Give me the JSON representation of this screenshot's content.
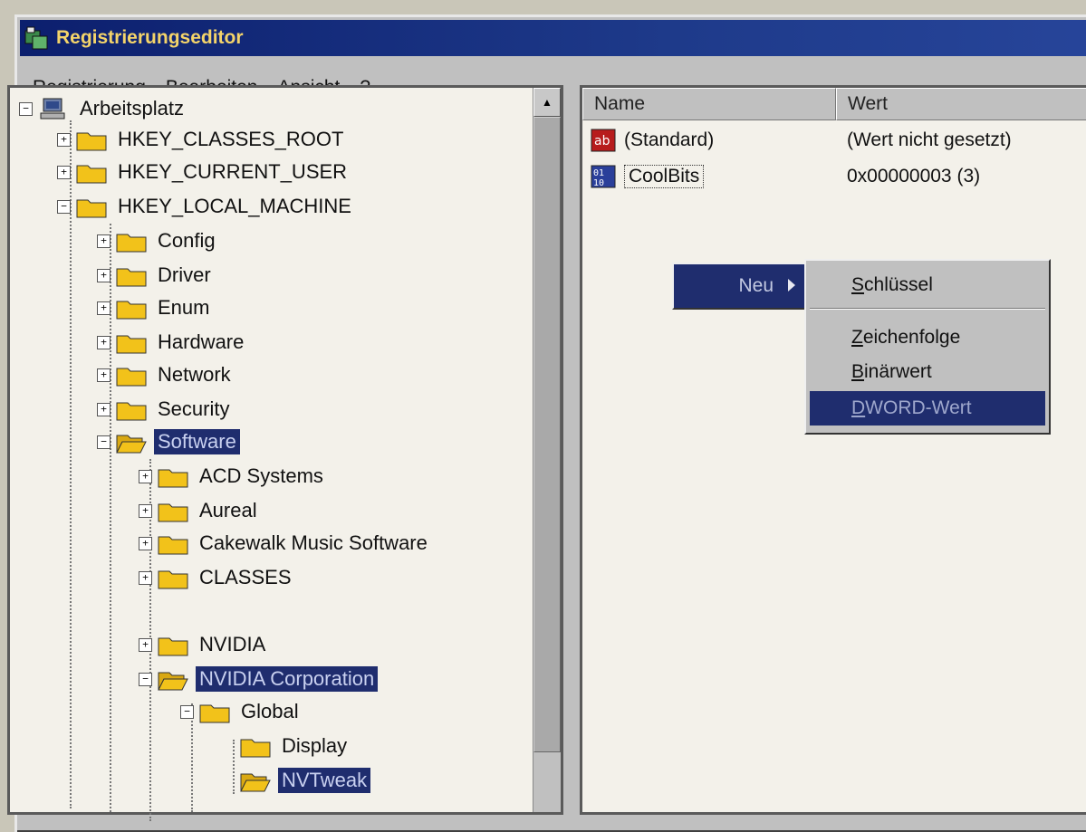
{
  "window": {
    "title": "Registrierungseditor"
  },
  "menubar": {
    "items": [
      {
        "underline": "R",
        "rest": "egistrierung"
      },
      {
        "underline": "B",
        "rest": "earbeiten"
      },
      {
        "underline": "A",
        "rest": "nsicht"
      },
      {
        "underline": "?",
        "rest": ""
      }
    ]
  },
  "tree": {
    "root": "Arbeitsplatz",
    "hkcr": "HKEY_CLASSES_ROOT",
    "hkcu": "HKEY_CURRENT_USER",
    "hklm": "HKEY_LOCAL_MACHINE",
    "config": "Config",
    "driver": "Driver",
    "enum": "Enum",
    "hardware": "Hardware",
    "network": "Network",
    "security": "Security",
    "software": "Software",
    "acd": "ACD Systems",
    "aureal": "Aureal",
    "cakewalk": "Cakewalk Music Software",
    "classes": "CLASSES",
    "nvidia": "NVIDIA",
    "nvidia_corp": "NVIDIA Corporation",
    "global": "Global",
    "display": "Display",
    "nvtweak": "NVTweak"
  },
  "list": {
    "col_name": "Name",
    "col_value": "Wert",
    "rows": [
      {
        "name": "(Standard)",
        "value": "(Wert nicht gesetzt)",
        "icon": "string-value-icon"
      },
      {
        "name": "CoolBits",
        "value": "0x00000003 (3)",
        "icon": "binary-value-icon"
      }
    ]
  },
  "context_menu": {
    "neu": "Neu",
    "submenu": [
      {
        "underline": "S",
        "rest": "chlüssel"
      },
      {
        "underline": "Z",
        "rest": "eichenfolge"
      },
      {
        "underline": "B",
        "rest": "inärwert"
      },
      {
        "underline": "D",
        "rest": "WORD-Wert"
      }
    ]
  },
  "colors": {
    "title_bar": "#1e3a8a",
    "selection": "#1f2d6e",
    "folder": "#f2c21a"
  }
}
